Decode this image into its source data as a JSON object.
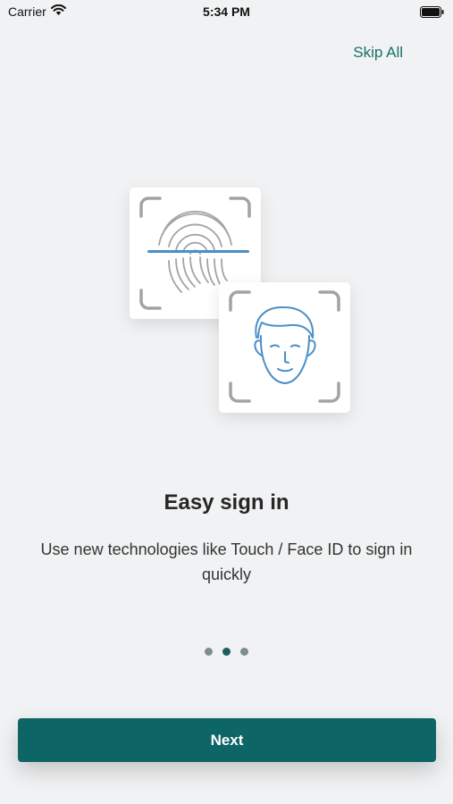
{
  "status_bar": {
    "carrier": "Carrier",
    "time": "5:34 PM",
    "wifi_icon": "wifi-icon",
    "battery_icon": "battery-icon"
  },
  "header": {
    "skip_label": "Skip All"
  },
  "illustration": {
    "fingerprint_icon": "fingerprint-icon",
    "face_id_icon": "face-id-icon",
    "accent_color": "#4a8fc8",
    "frame_color": "#a0a4a6"
  },
  "onboarding": {
    "title": "Easy sign in",
    "description": "Use new technologies like Touch / Face ID to sign in quickly",
    "page_count": 3,
    "current_page": 2
  },
  "footer": {
    "next_label": "Next",
    "button_color": "#0e6566"
  }
}
